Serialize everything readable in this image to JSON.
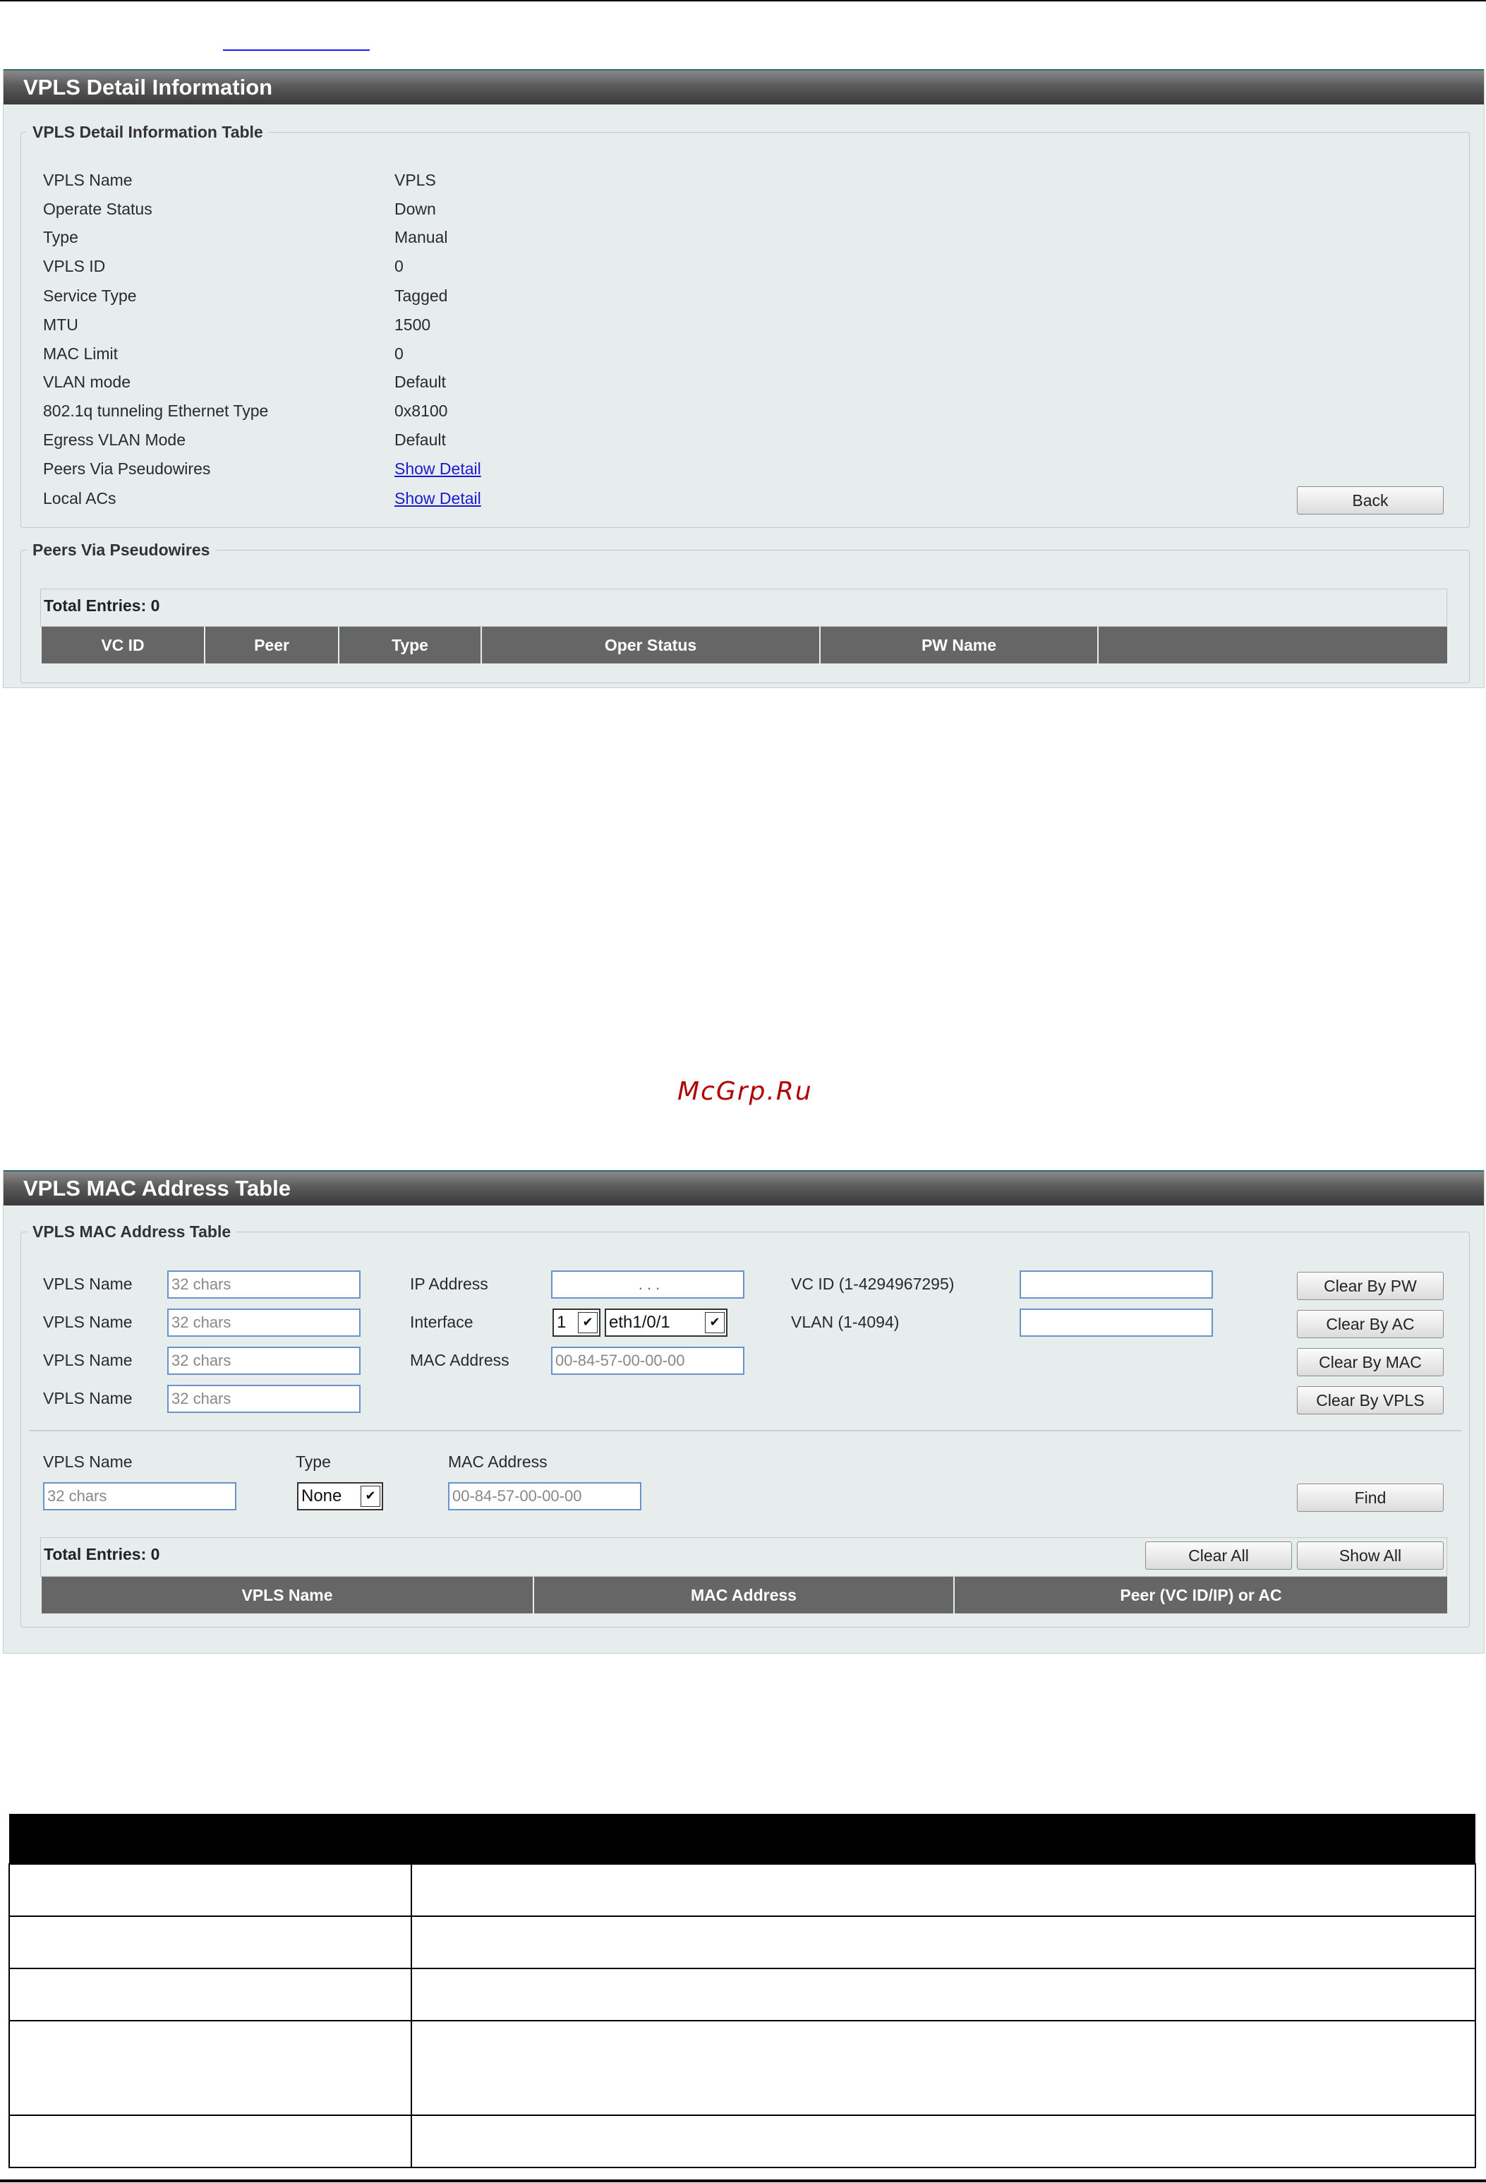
{
  "detail_panel": {
    "title": "VPLS Detail Information",
    "fieldset_title": "VPLS Detail Information Table",
    "rows": [
      {
        "label": "VPLS Name",
        "value": "VPLS"
      },
      {
        "label": "Operate Status",
        "value": "Down"
      },
      {
        "label": "Type",
        "value": "Manual"
      },
      {
        "label": "VPLS ID",
        "value": "0"
      },
      {
        "label": "Service Type",
        "value": "Tagged"
      },
      {
        "label": "MTU",
        "value": "1500"
      },
      {
        "label": "MAC Limit",
        "value": "0"
      },
      {
        "label": "VLAN mode",
        "value": "Default"
      },
      {
        "label": "802.1q tunneling Ethernet Type",
        "value": "0x8100"
      },
      {
        "label": "Egress VLAN Mode",
        "value": "Default"
      },
      {
        "label": "Peers Via Pseudowires",
        "value": "Show Detail"
      },
      {
        "label": "Local ACs",
        "value": "Show Detail"
      }
    ],
    "back_button": "Back",
    "peers": {
      "title": "Peers Via Pseudowires",
      "total_entries": "Total Entries: 0",
      "columns": [
        "VC ID",
        "Peer",
        "Type",
        "Oper Status",
        "PW Name",
        ""
      ]
    }
  },
  "watermark": "McGrp.Ru",
  "mac_panel": {
    "title": "VPLS MAC Address Table",
    "fieldset_title": "VPLS MAC Address Table",
    "clear_rows": [
      {
        "label": "VPLS Name",
        "placeholder": "32 chars",
        "mid_label": "IP Address",
        "mid_value": ".      .      .",
        "right_label": "VC ID (1-4294967295)",
        "button": "Clear By PW"
      },
      {
        "label": "VPLS Name",
        "placeholder": "32 chars",
        "mid_label": "Interface",
        "unit": "1",
        "port": "eth1/0/1",
        "right_label": "VLAN (1-4094)",
        "button": "Clear By AC"
      },
      {
        "label": "VPLS Name",
        "placeholder": "32 chars",
        "mid_label": "MAC Address",
        "mid_value": "00-84-57-00-00-00",
        "button": "Clear By MAC"
      },
      {
        "label": "VPLS Name",
        "placeholder": "32 chars",
        "button": "Clear By VPLS"
      }
    ],
    "find": {
      "name_label": "VPLS Name",
      "name_placeholder": "32 chars",
      "type_label": "Type",
      "type_value": "None",
      "mac_label": "MAC Address",
      "mac_placeholder": "00-84-57-00-00-00",
      "button": "Find"
    },
    "total_entries": "Total Entries: 0",
    "clear_all": "Clear All",
    "show_all": "Show All",
    "columns": [
      "VPLS Name",
      "MAC Address",
      "Peer (VC ID/IP) or AC"
    ]
  },
  "icons": {
    "dropdown": "chevron-down-icon"
  }
}
